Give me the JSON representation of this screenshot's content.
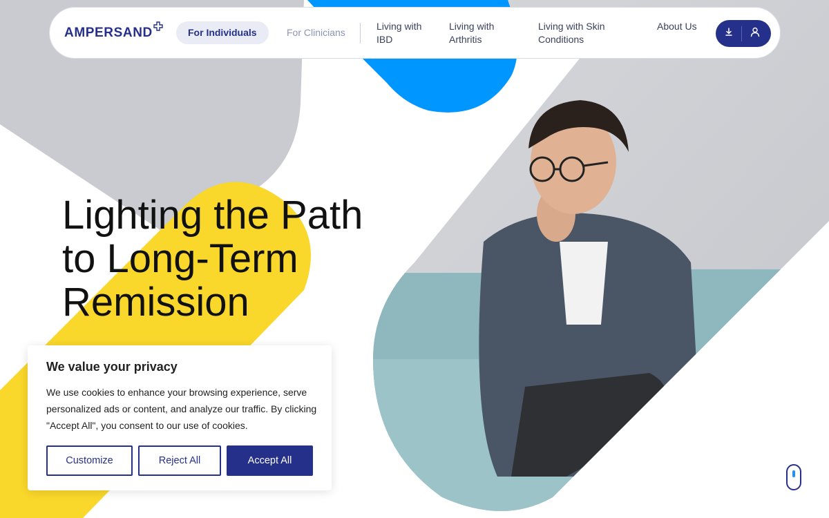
{
  "brand": {
    "name": "AMPERSAND",
    "colors": {
      "navy": "#25308a",
      "blue": "#0096ff",
      "yellow": "#f9d72b",
      "gray": "#c9cbd0"
    }
  },
  "nav": {
    "individuals": "For Individuals",
    "clinicians": "For Clinicians",
    "items": [
      {
        "label": "Living with IBD"
      },
      {
        "label": "Living with Arthritis"
      },
      {
        "label": "Living with Skin Conditions"
      },
      {
        "label": "About Us"
      }
    ],
    "icons": {
      "download": "download-icon",
      "account": "user-icon"
    }
  },
  "hero": {
    "title_line1": "Lighting the Path",
    "title_line2": "to Long-Term",
    "title_line3": "Remission"
  },
  "cookie_banner": {
    "title": "We value your privacy",
    "text": "We use cookies to enhance your browsing experience, serve personalized ads or content, and analyze our traffic. By clicking \"Accept All\", you consent to our use of cookies.",
    "customize": "Customize",
    "reject": "Reject All",
    "accept": "Accept All"
  }
}
